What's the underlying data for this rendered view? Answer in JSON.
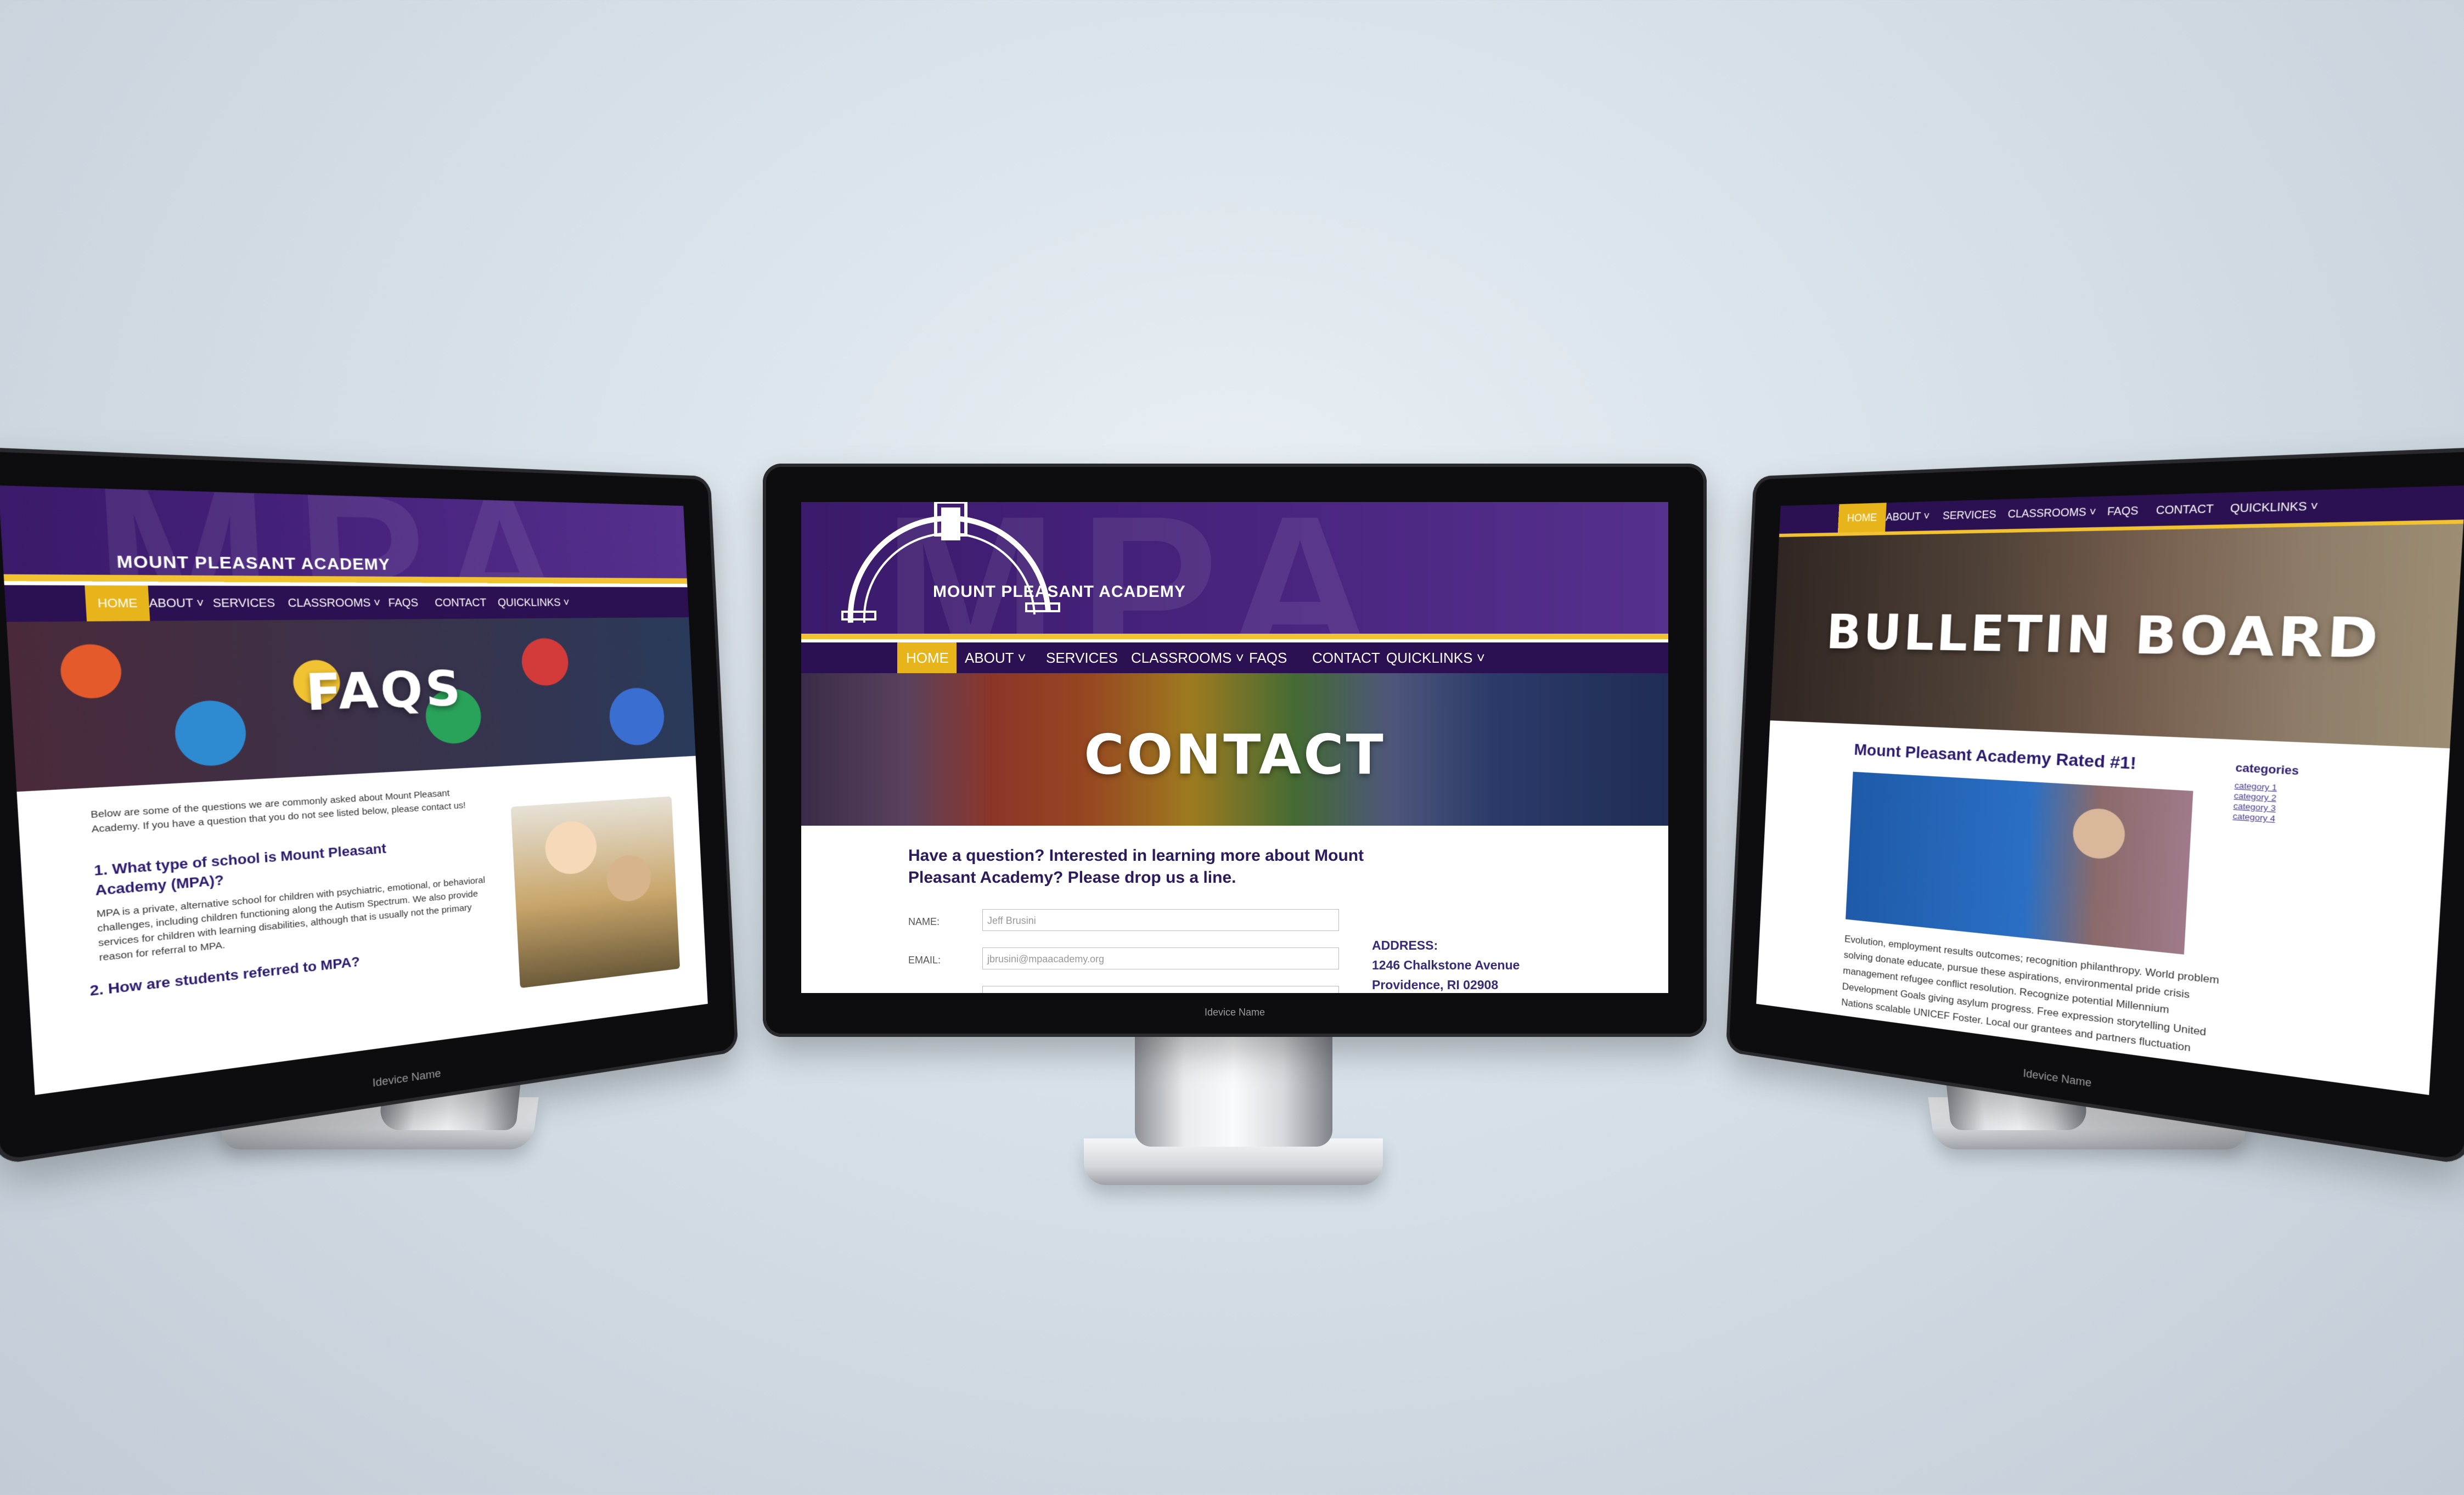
{
  "device_label": "Idevice Name",
  "site": {
    "logo_text": "MOUNT PLEASANT ACADEMY",
    "watermark": "MPA",
    "nav": [
      {
        "label": "HOME"
      },
      {
        "label": "ABOUT ˅"
      },
      {
        "label": "SERVICES"
      },
      {
        "label": "CLASSROOMS ˅"
      },
      {
        "label": "FAQS"
      },
      {
        "label": "CONTACT"
      },
      {
        "label": "QUICKLINKS ˅"
      }
    ]
  },
  "faq_page": {
    "hero_title": "FAQS",
    "intro": "Below are some of the questions we are commonly asked about Mount Pleasant Academy. If you have a question that you do not see listed below, please contact us!",
    "q1": "1. What type of school is Mount Pleasant Academy (MPA)?",
    "a1": "MPA is a private, alternative school for children with psychiatric, emotional, or behavioral challenges, including children functioning along the Autism Spectrum. We also provide services for children with learning disabilities, although that is usually not the primary reason for referral to MPA.",
    "q2": "2. How are students referred to MPA?"
  },
  "contact_page": {
    "hero_title": "CONTACT",
    "question": "Have a question? Interested in learning more about Mount Pleasant Academy? Please drop us a line.",
    "name_label": "NAME:",
    "name_value": "Jeff Brusini",
    "email_label": "EMAIL:",
    "email_value": "jbrusini@mpaacademy.org",
    "address_label": "ADDRESS:",
    "address_line1": "1246 Chalkstone Avenue",
    "address_line2": "Providence,  RI 02908"
  },
  "bulletin_page": {
    "hero_title": "BULLETIN BOARD",
    "post_title": "Mount Pleasant Academy Rated #1!",
    "categories_label": "categories",
    "categories": [
      "category 1",
      "category 2",
      "category 3",
      "category 4"
    ],
    "body_lines": [
      "Evolution, employment results outcomes; recognition philanthropy. World problem",
      "solving donate educate, pursue these aspirations, environmental pride crisis",
      "management refugee conflict resolution. Recognize potential Millennium",
      "Development Goals giving asylum progress. Free expression storytelling United",
      "Nations scalable UNICEF Foster. Local our grantees and partners fluctuation"
    ]
  },
  "colors": {
    "purple": "#3a1a6b",
    "nav_dark": "#2c1152",
    "gold": "#e8b41c"
  }
}
